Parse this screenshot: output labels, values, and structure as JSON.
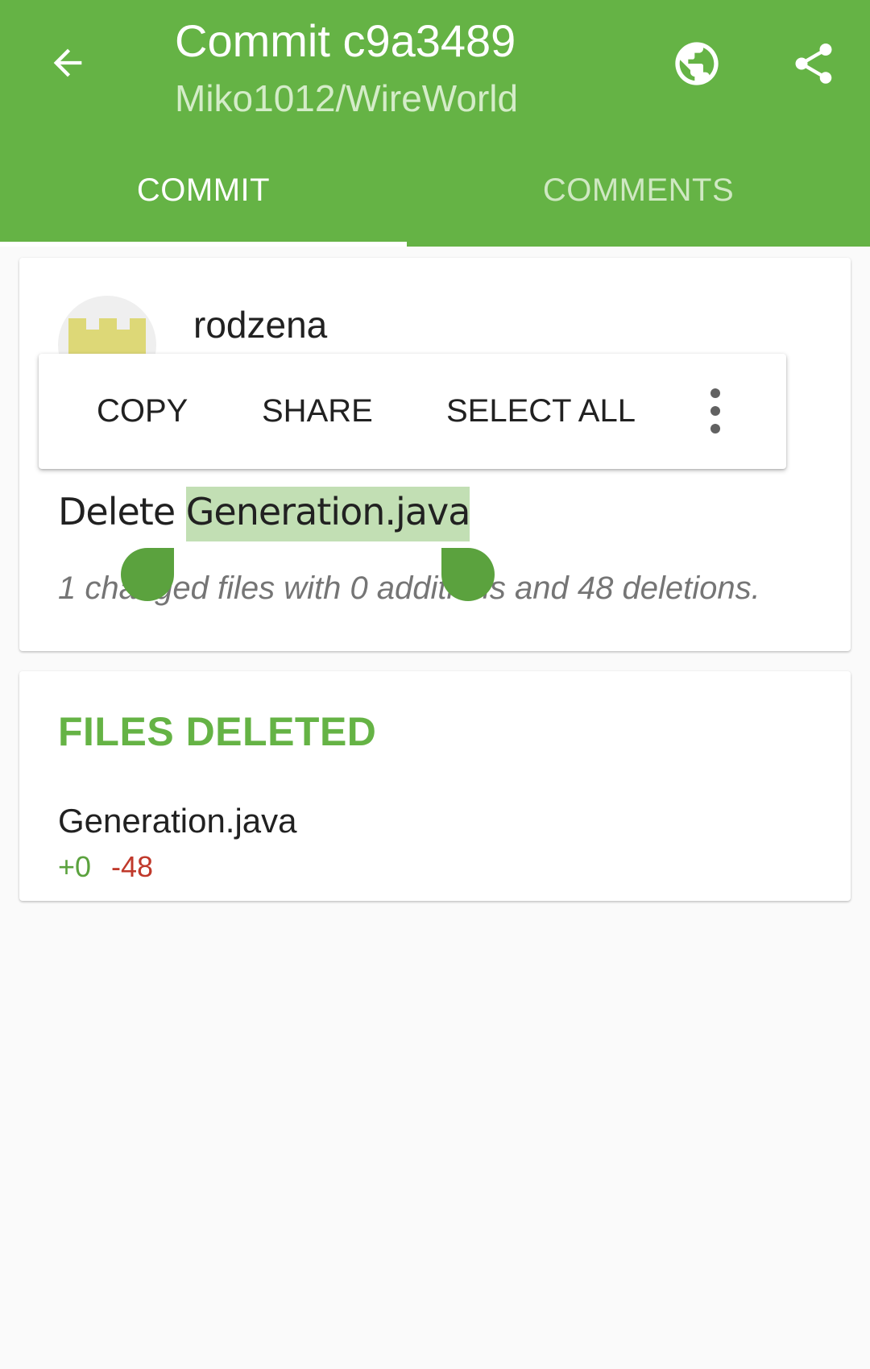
{
  "header": {
    "title": "Commit c9a3489",
    "subtitle": "Miko1012/WireWorld",
    "back_icon": "arrow-back-icon",
    "browser_icon": "globe-icon",
    "share_icon": "share-icon"
  },
  "tabs": [
    {
      "label": "COMMIT",
      "selected": true
    },
    {
      "label": "COMMENTS",
      "selected": false
    }
  ],
  "commit": {
    "author": "rodzena",
    "message_prefix": "Delete ",
    "message_selected": "Generation.java",
    "stats": "1 changed files with 0 additions and 48 deletions."
  },
  "selection_menu": {
    "copy": "COPY",
    "share": "SHARE",
    "select_all": "SELECT ALL",
    "more_icon": "more-vert-icon"
  },
  "files": {
    "section_title": "FILES DELETED",
    "items": [
      {
        "name": "Generation.java",
        "additions": "+0",
        "deletions": "-48"
      }
    ]
  },
  "colors": {
    "primary": "#65b345",
    "selection": "#c2dfb4",
    "handle": "#5ba23e",
    "deletions": "#c0392b"
  }
}
